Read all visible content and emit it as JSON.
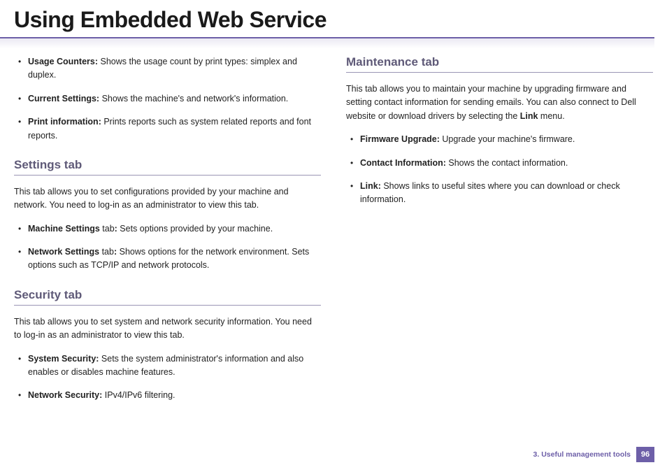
{
  "title": "Using Embedded Web Service",
  "left": {
    "top_items": [
      {
        "term": "Usage Counters:",
        "desc": " Shows the usage count by print types: simplex and duplex."
      },
      {
        "term": "Current Settings:",
        "desc": " Shows the machine's and network's information."
      },
      {
        "term": "Print information:",
        "desc": " Prints reports such as system related reports and font reports."
      }
    ],
    "settings": {
      "heading": "Settings tab",
      "desc": "This tab allows you to set configurations provided by your machine and network. You need to log-in as an administrator to view this tab.",
      "items": [
        {
          "term": "Machine Settings",
          "mid": " tab",
          "colon": ":",
          "desc": " Sets options provided by your machine."
        },
        {
          "term": "Network Settings",
          "mid": " tab",
          "colon": ":",
          "desc": " Shows options for the network environment. Sets options such as TCP/IP and network protocols."
        }
      ]
    },
    "security": {
      "heading": "Security tab",
      "desc": "This tab allows you to set system and network security information. You need to log-in as an administrator to view this tab.",
      "items": [
        {
          "term": "System Security:",
          "desc": " Sets the system administrator's information and also enables or disables machine features."
        },
        {
          "term": "Network Security:",
          "desc": "  IPv4/IPv6 filtering."
        }
      ]
    }
  },
  "right": {
    "maintenance": {
      "heading": "Maintenance tab",
      "desc_pre": "This tab allows you to maintain your machine by upgrading firmware and setting contact information for sending emails. You can also connect to Dell website or download drivers by selecting the ",
      "desc_bold": "Link",
      "desc_post": " menu.",
      "items": [
        {
          "term": "Firmware Upgrade:",
          "desc": " Upgrade your machine's firmware."
        },
        {
          "term": "Contact Information:",
          "desc": " Shows the contact information."
        },
        {
          "term": "Link:",
          "desc": " Shows links to useful sites where you can download or check information."
        }
      ]
    }
  },
  "footer": {
    "chapter": "3.  Useful management tools",
    "page": "96"
  }
}
